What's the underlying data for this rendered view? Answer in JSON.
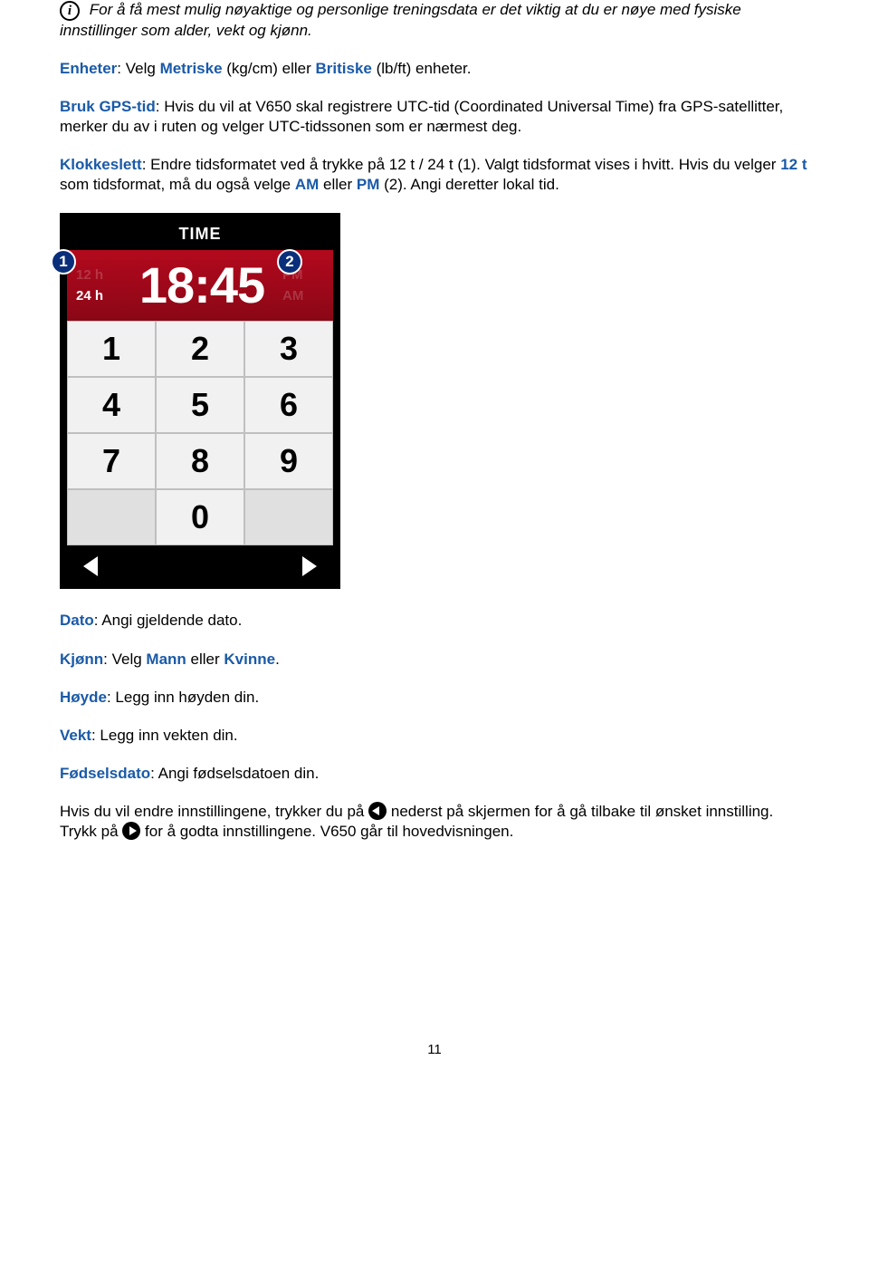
{
  "intro": {
    "text": "For å få mest mulig nøyaktige og personlige treningsdata er det viktig at du er nøye med fysiske innstillinger som alder, vekt og kjønn."
  },
  "enheter": {
    "label": "Enheter",
    "sep": ": Velg ",
    "opt1": "Metriske",
    "mid1": " (kg/cm) eller ",
    "opt2": "Britiske",
    "tail": " (lb/ft) enheter."
  },
  "gps": {
    "label": "Bruk GPS-tid",
    "text": ": Hvis du vil at V650 skal registrere UTC-tid (Coordinated Universal Time) fra GPS-satellitter, merker du av i ruten og velger UTC-tidssonen som er nærmest deg."
  },
  "klokke": {
    "label": "Klokkeslett",
    "p1": ": Endre tidsformatet ved å trykke på 12 t / 24 t (1). Valgt tidsformat vises i hvitt. Hvis du velger ",
    "t12": "12 t",
    "p2": " som tidsformat, må du også velge ",
    "am": "AM",
    "mid": " eller ",
    "pm": "PM",
    "p3": " (2). Angi deretter lokal tid."
  },
  "device": {
    "title": "TIME",
    "h12": "12 h",
    "h24": "24 h",
    "time": "18:45",
    "pm": "PM",
    "am": "AM",
    "keys": [
      "1",
      "2",
      "3",
      "4",
      "5",
      "6",
      "7",
      "8",
      "9",
      "",
      "0",
      ""
    ],
    "callout1": "1",
    "callout2": "2"
  },
  "dato": {
    "label": "Dato",
    "text": ": Angi gjeldende dato."
  },
  "kjonn": {
    "label": "Kjønn",
    "pre": ": Velg ",
    "m": "Mann",
    "mid": " eller ",
    "k": "Kvinne",
    "tail": "."
  },
  "hoyde": {
    "label": "Høyde",
    "text": ": Legg inn høyden din."
  },
  "vekt": {
    "label": "Vekt",
    "text": ": Legg inn vekten din."
  },
  "fdato": {
    "label": "Fødselsdato",
    "text": ": Angi fødselsdatoen din."
  },
  "outro": {
    "p1": "Hvis du vil endre innstillingene, trykker du på ",
    "p2": " nederst på skjermen for å gå tilbake til ønsket innstilling. Trykk på ",
    "p3": " for å godta innstillingene. V650 går til hovedvisningen."
  },
  "page": "11"
}
